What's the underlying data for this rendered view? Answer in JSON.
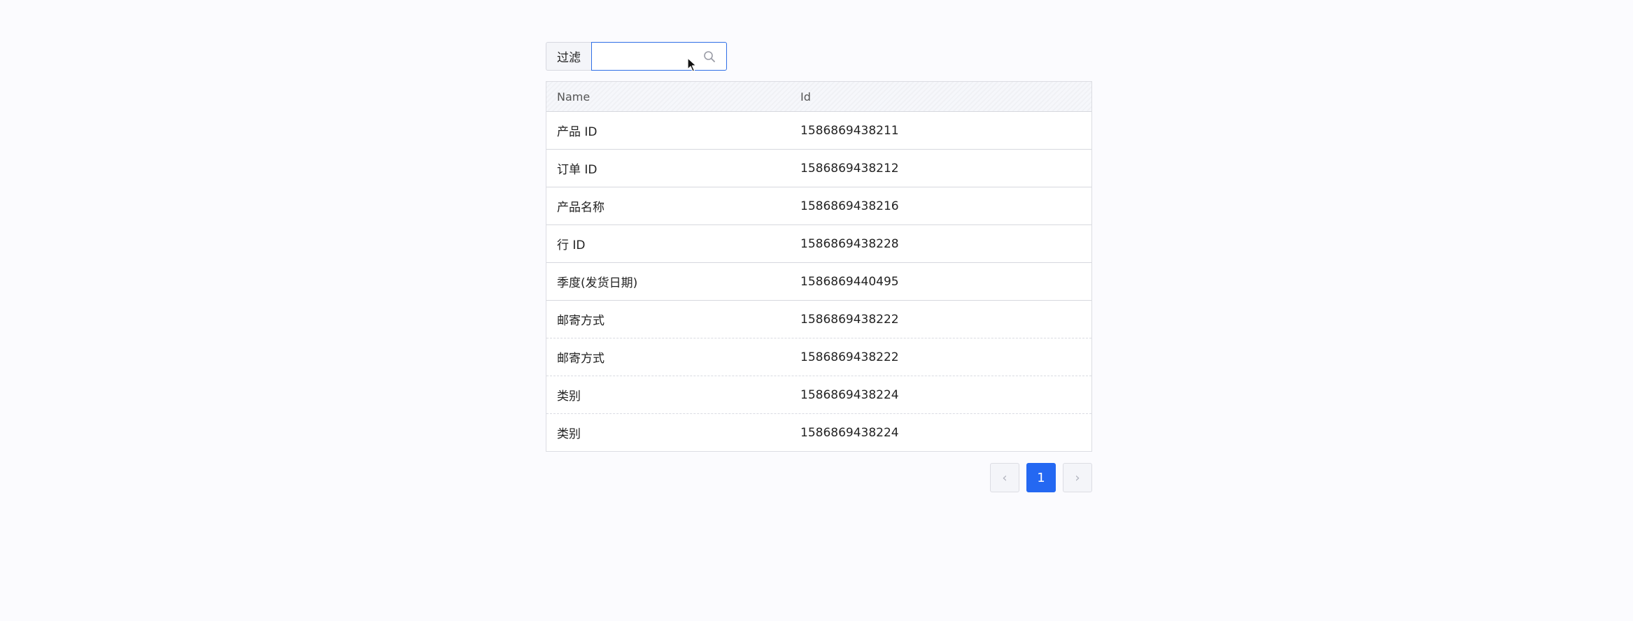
{
  "filter": {
    "label": "过滤",
    "value": "",
    "placeholder": ""
  },
  "table": {
    "columns": [
      "Name",
      "Id"
    ],
    "rows": [
      {
        "name": "产品 ID",
        "id": "1586869438211"
      },
      {
        "name": "订单 ID",
        "id": "1586869438212"
      },
      {
        "name": "产品名称",
        "id": "1586869438216"
      },
      {
        "name": "行 ID",
        "id": "1586869438228"
      },
      {
        "name": "季度(发货日期)",
        "id": "1586869440495"
      },
      {
        "name": "邮寄方式",
        "id": "1586869438222"
      },
      {
        "name": "邮寄方式",
        "id": "1586869438222"
      },
      {
        "name": "类别",
        "id": "1586869438224"
      },
      {
        "name": "类别",
        "id": "1586869438224"
      }
    ]
  },
  "pagination": {
    "prev_label": "‹",
    "current_page": "1",
    "next_label": "›"
  },
  "colors": {
    "accent": "#2468f2",
    "input_focus_border": "#2f6fe6",
    "background": "#fbfbfe"
  },
  "icons": {
    "search": "search-icon",
    "cursor": "mouse-pointer-icon",
    "prev": "chevron-left-icon",
    "next": "chevron-right-icon"
  }
}
